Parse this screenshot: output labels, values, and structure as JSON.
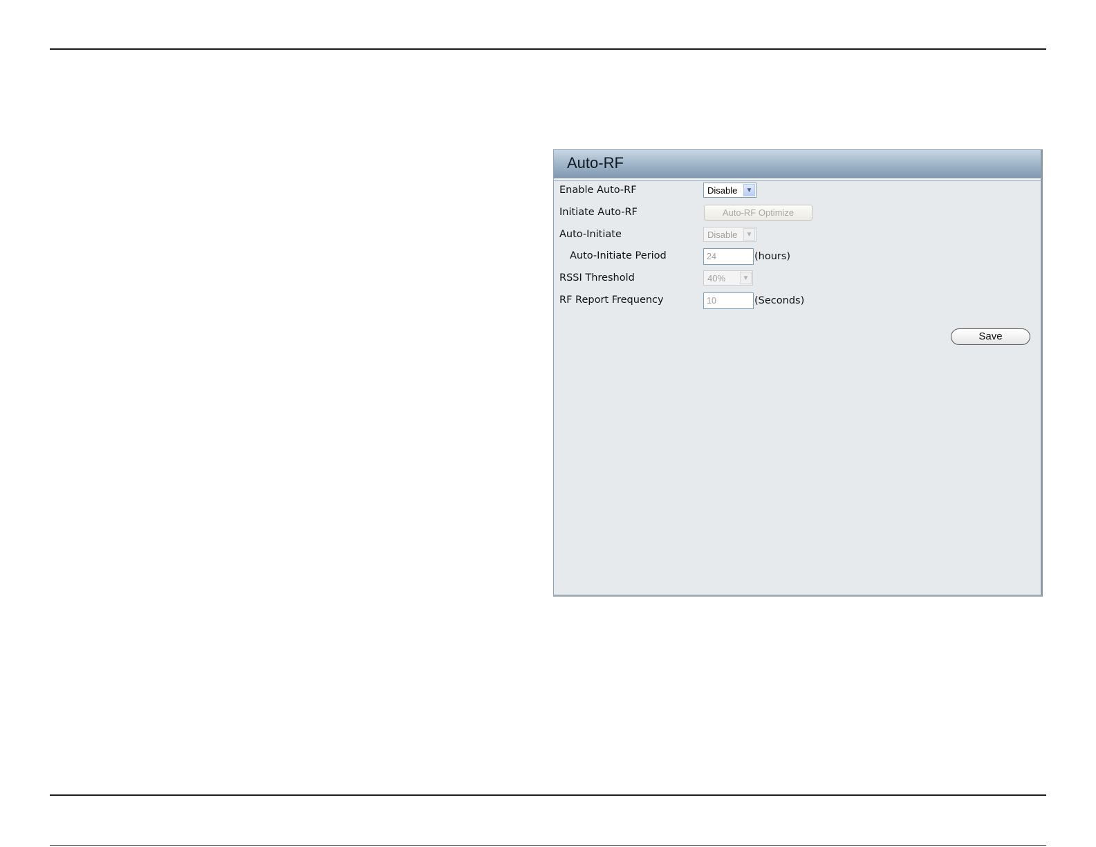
{
  "panel": {
    "title": "Auto-RF",
    "rows": {
      "enable": {
        "label": "Enable Auto-RF",
        "value": "Disable"
      },
      "initiate": {
        "label": "Initiate Auto-RF",
        "button": "Auto-RF Optimize"
      },
      "auto_initiate": {
        "label": "Auto-Initiate",
        "value": "Disable"
      },
      "period": {
        "label": "Auto-Initiate Period",
        "value": "24",
        "unit": "(hours)"
      },
      "rssi": {
        "label": "RSSI Threshold",
        "value": "40%"
      },
      "report": {
        "label": "RF Report Frequency",
        "value": "10",
        "unit": "(Seconds)"
      }
    },
    "save_label": "Save"
  },
  "colors": {
    "panel_bg": "#e6eaec",
    "header_gradient_top": "#c8d6e3",
    "header_gradient_bottom": "#7f98b0",
    "input_border": "#7f9db9",
    "disabled_text": "#a0a0a0"
  },
  "icons": {
    "dropdown": "chevron-down-icon"
  }
}
